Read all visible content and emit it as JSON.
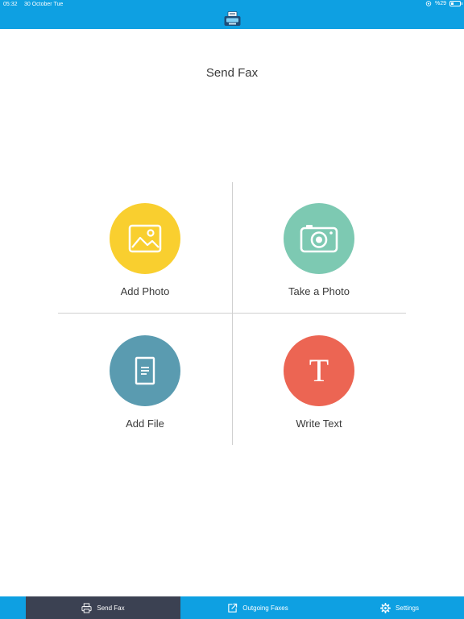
{
  "status_bar": {
    "time": "05:32",
    "date": "30 October Tue",
    "battery": "%29"
  },
  "app": {
    "logo_icon": "fax-machine-icon",
    "brand_color": "#0ea0e2"
  },
  "page": {
    "title": "Send Fax"
  },
  "actions": [
    {
      "label": "Add Photo",
      "icon": "image-icon",
      "color": "#f9cf2f"
    },
    {
      "label": "Take a Photo",
      "icon": "camera-icon",
      "color": "#7dc9b2"
    },
    {
      "label": "Add File",
      "icon": "document-icon",
      "color": "#5a9bb0"
    },
    {
      "label": "Write Text",
      "icon": "text-t-icon",
      "glyph": "T",
      "color": "#ec6553"
    }
  ],
  "tabbar": {
    "tabs": [
      {
        "label": "Send Fax",
        "icon": "printer-icon",
        "active": true
      },
      {
        "label": "Outgoing Faxes",
        "icon": "external-link-icon",
        "active": false
      },
      {
        "label": "Settings",
        "icon": "gear-icon",
        "active": false
      }
    ],
    "active_color": "#3b4152"
  }
}
